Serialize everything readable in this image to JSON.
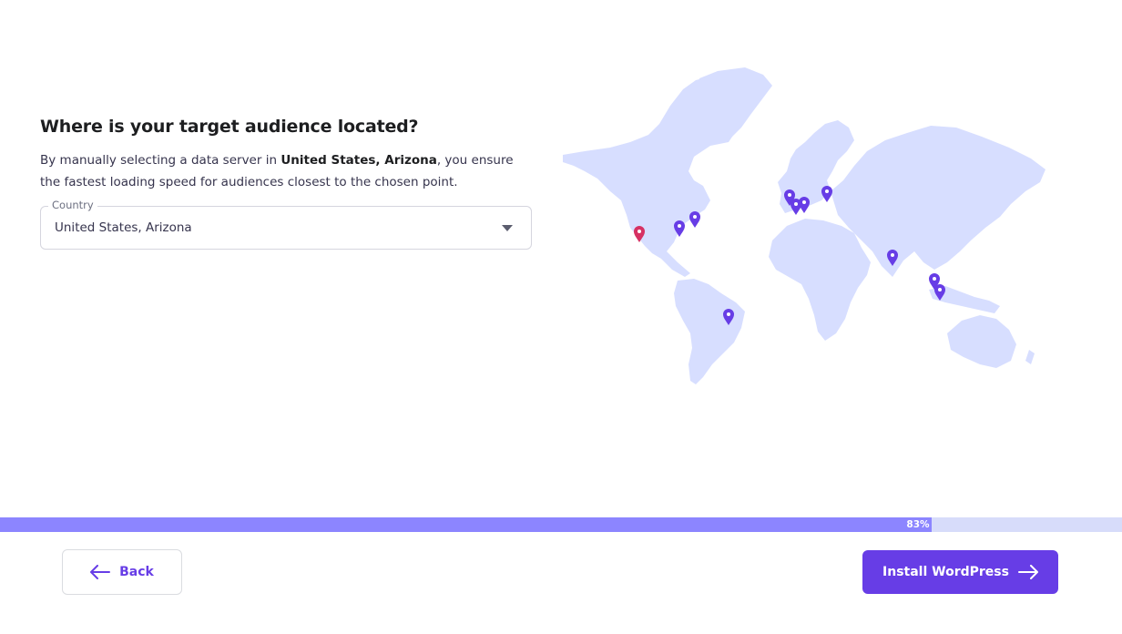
{
  "header": {
    "title": "Where is your target audience located?",
    "description_prefix": "By manually selecting a data server in ",
    "description_bold": "United States, Arizona",
    "description_suffix": ", you ensure the fastest loading speed for audiences closest to the chosen point."
  },
  "country_select": {
    "label": "Country",
    "value": "United States, Arizona",
    "icon": "chevron-down-icon"
  },
  "map": {
    "land_color": "#d7deff",
    "selected_pin_color": "#d63163",
    "pin_color": "#673de6",
    "pins": [
      {
        "name": "arizona",
        "selected": true
      },
      {
        "name": "us-east",
        "selected": false
      },
      {
        "name": "us-northeast",
        "selected": false
      },
      {
        "name": "brazil",
        "selected": false
      },
      {
        "name": "uk",
        "selected": false
      },
      {
        "name": "netherlands",
        "selected": false
      },
      {
        "name": "germany",
        "selected": false
      },
      {
        "name": "lithuania",
        "selected": false
      },
      {
        "name": "india",
        "selected": false
      },
      {
        "name": "malaysia",
        "selected": false
      },
      {
        "name": "singapore",
        "selected": false
      }
    ]
  },
  "progress": {
    "value": 0.83,
    "label": "83%"
  },
  "footer": {
    "back_label": "Back",
    "back_icon": "arrow-left-icon",
    "install_label": "Install WordPress",
    "install_icon": "arrow-right-icon"
  },
  "colors": {
    "accent": "#673de6",
    "progress_fill": "#8c85ff",
    "progress_track": "#d7dcfa"
  }
}
